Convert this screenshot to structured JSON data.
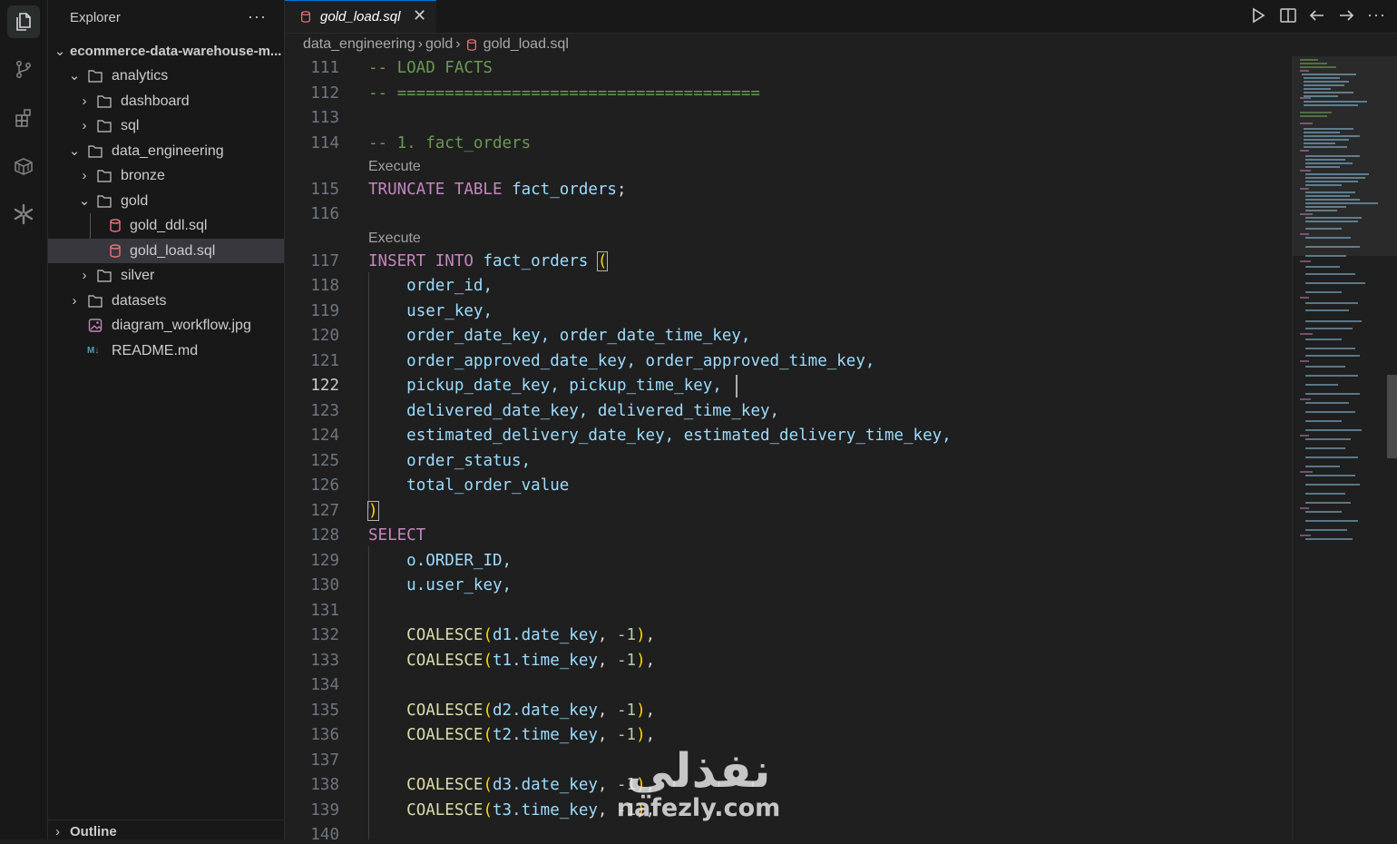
{
  "activity_bar": {
    "items": [
      {
        "icon": "files-icon",
        "active": true
      },
      {
        "icon": "source-control-icon"
      },
      {
        "icon": "extensions-icon"
      },
      {
        "icon": "database-icon"
      },
      {
        "icon": "snowflake-icon"
      }
    ]
  },
  "sidebar": {
    "title": "Explorer",
    "more": "···",
    "project": "ecommerce-data-warehouse-m...",
    "tree": [
      {
        "label": "analytics",
        "type": "folder",
        "expanded": true,
        "depth": 1
      },
      {
        "label": "dashboard",
        "type": "folder",
        "expanded": false,
        "depth": 2
      },
      {
        "label": "sql",
        "type": "folder",
        "expanded": false,
        "depth": 2
      },
      {
        "label": "data_engineering",
        "type": "folder",
        "expanded": true,
        "depth": 1
      },
      {
        "label": "bronze",
        "type": "folder",
        "expanded": false,
        "depth": 2
      },
      {
        "label": "gold",
        "type": "folder",
        "expanded": true,
        "depth": 2
      },
      {
        "label": "gold_ddl.sql",
        "type": "sql",
        "depth": 3
      },
      {
        "label": "gold_load.sql",
        "type": "sql",
        "depth": 3,
        "selected": true
      },
      {
        "label": "silver",
        "type": "folder",
        "expanded": false,
        "depth": 2
      },
      {
        "label": "datasets",
        "type": "folder",
        "expanded": false,
        "depth": 1
      },
      {
        "label": "diagram_workflow.jpg",
        "type": "image",
        "depth": 1
      },
      {
        "label": "README.md",
        "type": "markdown",
        "depth": 1
      }
    ],
    "outline": "Outline"
  },
  "editor": {
    "tab": {
      "label": "gold_load.sql",
      "close": "✕"
    },
    "breadcrumb": [
      "data_engineering",
      "gold",
      "gold_load.sql"
    ],
    "current_line": "122",
    "code_lens": "Execute",
    "lines": {
      "l111": "111",
      "l112": "112",
      "l113": "113",
      "l114": "114",
      "l115": "115",
      "l116": "116",
      "l117": "117",
      "l118": "118",
      "l119": "119",
      "l120": "120",
      "l121": "121",
      "l122": "122",
      "l123": "123",
      "l124": "124",
      "l125": "125",
      "l126": "126",
      "l127": "127",
      "l128": "128",
      "l129": "129",
      "l130": "130",
      "l131": "131",
      "l132": "132",
      "l133": "133",
      "l134": "134",
      "l135": "135",
      "l136": "136",
      "l137": "137",
      "l138": "138",
      "l139": "139",
      "l140": "140"
    },
    "code": {
      "c111": "-- LOAD FACTS",
      "c112": "-- ======================================",
      "c114": "-- 1. fact_orders",
      "truncate_kw": "TRUNCATE TABLE",
      "fact_orders": "fact_orders",
      "semicolon": ";",
      "insert_kw": "INSERT INTO",
      "open_paren": "(",
      "close_paren": ")",
      "c118": "order_id,",
      "c119": "user_key,",
      "c120": "order_date_key, order_date_time_key,",
      "c121": "order_approved_date_key, order_approved_time_key,",
      "c122": "pickup_date_key, pickup_time_key,",
      "c123": "delivered_date_key, delivered_time_key,",
      "c124": "estimated_delivery_date_key, estimated_delivery_time_key,",
      "c125": "order_status,",
      "c126": "total_order_value",
      "select_kw": "SELECT",
      "c129": "o.ORDER_ID,",
      "c130": "u.user_key,",
      "coalesce": "COALESCE",
      "neg_one": "-1",
      "c132_arg": "d1.date_key",
      "c133_arg": "t1.time_key",
      "c135_arg": "d2.date_key",
      "c136_arg": "t2.time_key",
      "c138_arg": "d3.date_key",
      "c139_arg": "t3.time_key"
    }
  },
  "watermark": {
    "arabic": "نفذلي",
    "latin": "nafezly.com"
  },
  "colors": {
    "background": "#1f1f1f",
    "sidebar": "#181818",
    "comment": "#6a9955",
    "keyword": "#c586c0",
    "identifier": "#9cdcfe",
    "function": "#dcdcaa",
    "number": "#b5cea8",
    "bracket": "#ffd700",
    "accent": "#0078d4"
  }
}
